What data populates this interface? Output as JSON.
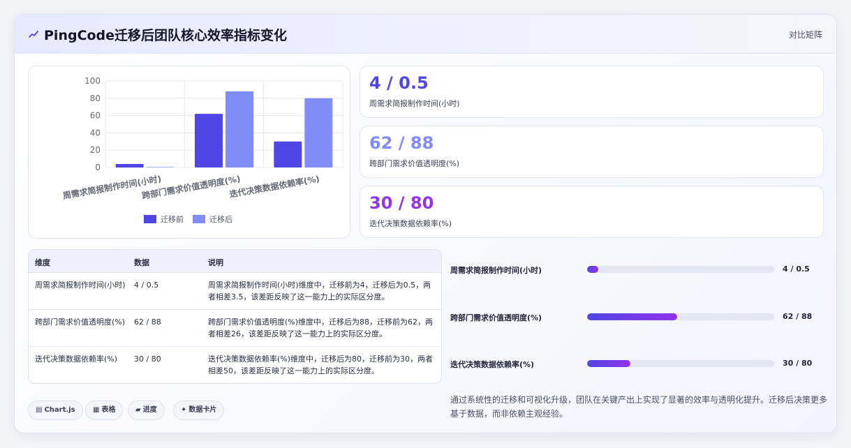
{
  "header": {
    "title": "PingCode迁移后团队核心效率指标变化",
    "mode": "对比矩阵",
    "icon": "trend-line-icon"
  },
  "colors": {
    "before": "#4f46e5",
    "after": "#818cf8",
    "stat1": "#4f46e5",
    "stat2": "#818cf8",
    "stat3": "#9333ea"
  },
  "chart_data": {
    "type": "bar",
    "categories": [
      "周需求简报制作时间(小时)",
      "跨部门需求价值透明度(%)",
      "迭代决策数据依赖率(%)"
    ],
    "series": [
      {
        "name": "迁移前",
        "values": [
          4,
          62,
          30
        ]
      },
      {
        "name": "迁移后",
        "values": [
          0.5,
          88,
          80
        ]
      }
    ],
    "ylim": [
      0,
      100
    ],
    "yticks": [
      "0",
      "20",
      "40",
      "60",
      "80",
      "100"
    ],
    "grid": true,
    "legend": "bottom"
  },
  "stats": [
    {
      "value": "4 / 0.5",
      "label": "周需求简报制作时间(小时)"
    },
    {
      "value": "62 / 88",
      "label": "跨部门需求价值透明度(%)"
    },
    {
      "value": "30 / 80",
      "label": "迭代决策数据依赖率(%)"
    }
  ],
  "table": {
    "headers": [
      "维度",
      "数据",
      "说明"
    ],
    "rows": [
      {
        "dim": "周需求简报制作时间(小时)",
        "data": "4 / 0.5",
        "desc": "周需求简报制作时间(小时)维度中，迁移前为4，迁移后为0.5，两者相差3.5，该差距反映了这一能力上的实际区分度。"
      },
      {
        "dim": "跨部门需求价值透明度(%)",
        "data": "62 / 88",
        "desc": "跨部门需求价值透明度(%)维度中，迁移后为88，迁移前为62，两者相差26，该差距反映了这一能力上的实际区分度。"
      },
      {
        "dim": "迭代决策数据依赖率(%)",
        "data": "30 / 80",
        "desc": "迭代决策数据依赖率(%)维度中，迁移后为80，迁移前为30，两者相差50，该差距反映了这一能力上的实际区分度。"
      }
    ]
  },
  "progress": [
    {
      "label": "周需求简报制作时间(小时)",
      "value": "4 / 0.5",
      "fill": 0.06
    },
    {
      "label": "跨部门需求价值透明度(%)",
      "value": "62 / 88",
      "fill": 0.48
    },
    {
      "label": "迭代决策数据依赖率(%)",
      "value": "30 / 80",
      "fill": 0.23
    }
  ],
  "summary": "通过系统性的迁移和可视化升级，团队在关键产出上实现了显著的效率与透明化提升。迁移后决策更多基于数据，而非依赖主观经验。",
  "tags": [
    {
      "label": "Chart.js",
      "icon": "chart-icon"
    },
    {
      "label": "表格",
      "icon": "table-icon"
    },
    {
      "label": "进度",
      "icon": "progress-icon"
    },
    {
      "label": "数据卡片",
      "icon": "card-icon"
    }
  ]
}
